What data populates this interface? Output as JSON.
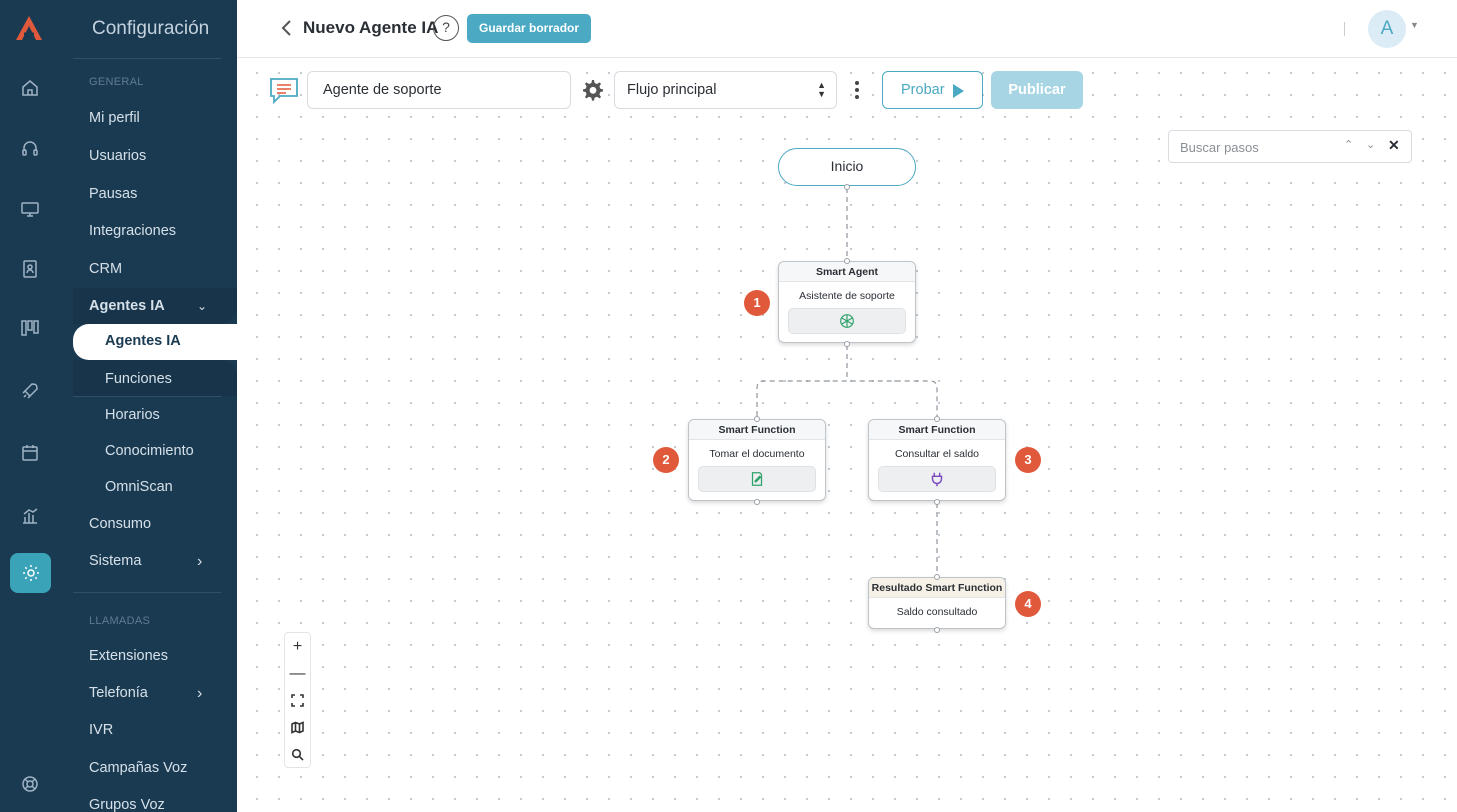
{
  "sidebar": {
    "title": "Configuración",
    "section_general": "GENERAL",
    "section_calls": "LLAMADAS",
    "items": {
      "mi_perfil": "Mi perfil",
      "usuarios": "Usuarios",
      "pausas": "Pausas",
      "integraciones": "Integraciones",
      "crm": "CRM",
      "agentes_ia_group": "Agentes IA",
      "agentes_ia": "Agentes IA",
      "funciones": "Funciones",
      "horarios": "Horarios",
      "conocimiento": "Conocimiento",
      "omniscan": "OmniScan",
      "consumo": "Consumo",
      "sistema": "Sistema",
      "extensiones": "Extensiones",
      "telefonia": "Telefonía",
      "ivr": "IVR",
      "campanas_voz": "Campañas Voz",
      "grupos_voz": "Grupos Voz"
    },
    "rail_icons": [
      "home-icon",
      "headset-icon",
      "monitor-icon",
      "contacts-icon",
      "kanban-icon",
      "rocket-icon",
      "calendar-icon",
      "chart-icon",
      "settings-icon",
      "help-lifebuoy-icon"
    ]
  },
  "header": {
    "title": "Nuevo Agente IA",
    "help": "?",
    "save_draft": "Guardar borrador",
    "avatar_letter": "A"
  },
  "toolbar": {
    "agent_name": "Agente de soporte",
    "flow_selected": "Flujo principal",
    "test_label": "Probar",
    "publish_label": "Publicar"
  },
  "search_steps": {
    "placeholder": "Buscar pasos"
  },
  "flow": {
    "start_label": "Inicio",
    "nodes": [
      {
        "badge": "1",
        "type": "Smart Agent",
        "body": "Asistente de soporte",
        "icon": "openai-icon"
      },
      {
        "badge": "2",
        "type": "Smart Function",
        "body": "Tomar el documento",
        "icon": "document-edit-icon"
      },
      {
        "badge": "3",
        "type": "Smart Function",
        "body": "Consultar el saldo",
        "icon": "plug-icon"
      },
      {
        "badge": "4",
        "type": "Resultado Smart Function",
        "body": "Saldo consultado",
        "icon": ""
      }
    ]
  },
  "zoom_controls": {
    "zoom_in": "+",
    "zoom_out": "—"
  },
  "colors": {
    "sidebar_bg": "#1a3a52",
    "accent": "#4ba9c3",
    "badge": "#e0593a"
  }
}
